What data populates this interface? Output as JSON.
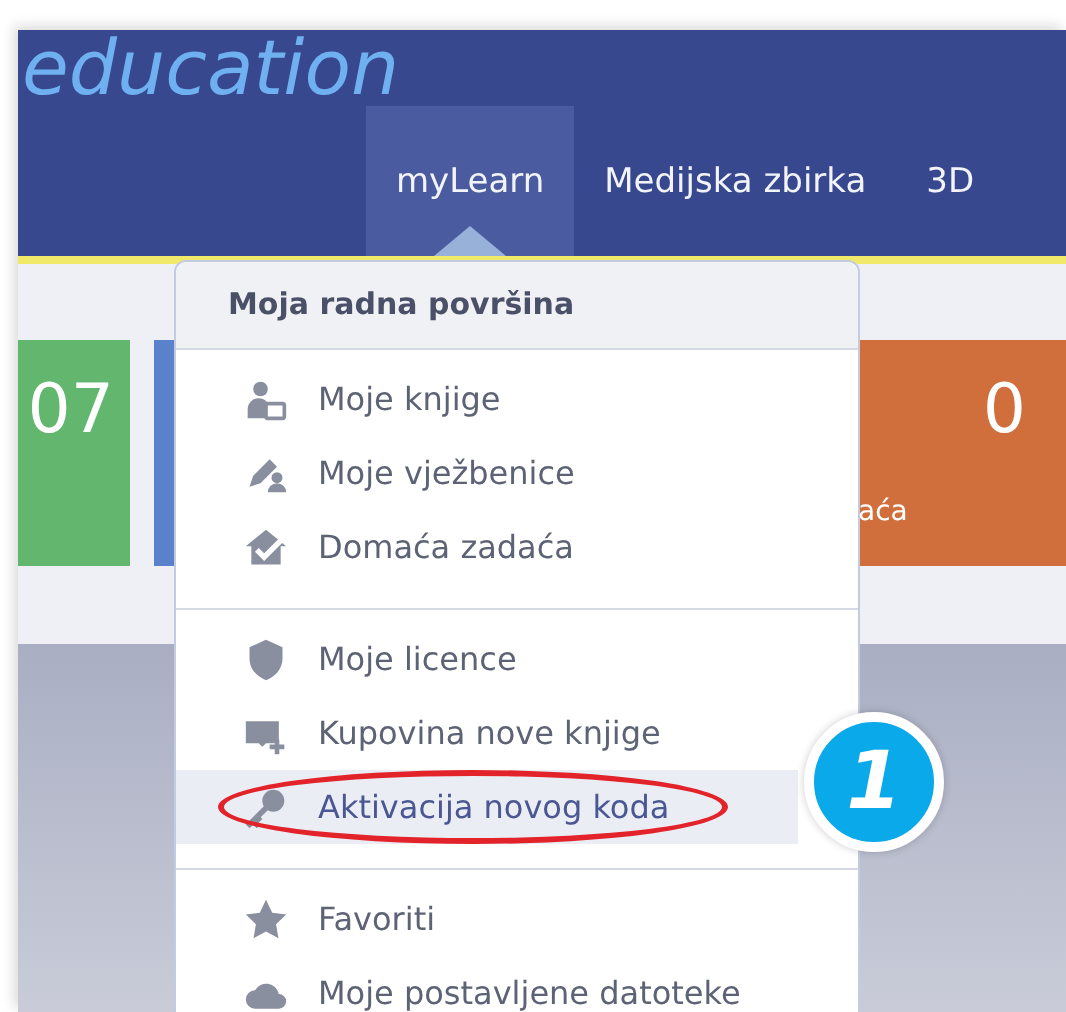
{
  "logo": {
    "text": "education"
  },
  "nav": [
    {
      "label": "myLearn",
      "selected": true
    },
    {
      "label": "Medijska zbirka",
      "selected": false
    },
    {
      "label": "3D",
      "selected": false
    }
  ],
  "stat_cards": [
    {
      "value": "07",
      "color": "#63b66e"
    },
    {
      "color": "#5a82cc"
    },
    {
      "value": "0",
      "label": "aća",
      "color": "#d16f3c"
    }
  ],
  "dropdown": {
    "title": "Moja radna površina",
    "groups": [
      [
        {
          "kind": "books",
          "label": "Moje knjige",
          "selected": false,
          "circled": false
        },
        {
          "kind": "workbook",
          "label": "Moje vježbenice",
          "selected": false,
          "circled": false
        },
        {
          "kind": "homework",
          "label": "Domaća zadaća",
          "selected": false,
          "circled": false
        }
      ],
      [
        {
          "kind": "license",
          "label": "Moje licence",
          "selected": false,
          "circled": false
        },
        {
          "kind": "buy",
          "label": "Kupovina nove knjige",
          "selected": false,
          "circled": false
        },
        {
          "kind": "key",
          "label": "Aktivacija novog koda",
          "selected": true,
          "circled": true
        }
      ],
      [
        {
          "kind": "star",
          "label": "Favoriti",
          "selected": false,
          "circled": false
        },
        {
          "kind": "upload",
          "label": "Moje postavljene datoteke",
          "selected": false,
          "circled": false
        }
      ]
    ]
  },
  "step_badge": {
    "text": "1"
  }
}
